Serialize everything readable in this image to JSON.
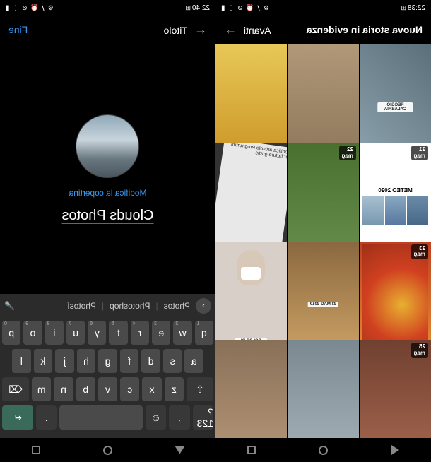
{
  "status": {
    "time_left": "22:38",
    "time_right": "22:40",
    "battery": "32",
    "icons": "⚙ ᚋ ⏰ ⊘ ⋮"
  },
  "left_screen": {
    "header_title": "Nuova storia in evidenza",
    "header_action": "Avanti",
    "tiles": [
      {
        "date": "",
        "bg": "linear-gradient(135deg,#5a6f7a,#8fa5b0)",
        "label": "REGGIO CALABRIA"
      },
      {
        "date": "",
        "bg": "linear-gradient(#b09878,#8a7458)",
        "label": ""
      },
      {
        "date": "",
        "bg": "linear-gradient(#e8c858,#c89020)",
        "label": ""
      },
      {
        "date": "21 mag",
        "bg": "#fff",
        "label": "METEO 2020",
        "meteo": true
      },
      {
        "date": "22 mag",
        "bg": "linear-gradient(#4a7030,#6a9050)",
        "label": ""
      },
      {
        "date": "",
        "bg": "#e8e8e8",
        "label": "Modifica articolo Programmi per fatture gratis",
        "doc": true
      },
      {
        "date": "23 mag",
        "bg": "linear-gradient(#c04020,#e89638)",
        "label": "",
        "pasta": true
      },
      {
        "date": "",
        "bg": "linear-gradient(#8a6840,#d4a868)",
        "label": "23 MAG 2019"
      },
      {
        "date": "",
        "bg": "#d8d0c8",
        "label": "COLPO DI FULMINE",
        "mask": true
      },
      {
        "date": "25 mag",
        "bg": "linear-gradient(#704030,#a86850)",
        "label": ""
      },
      {
        "date": "",
        "bg": "linear-gradient(#7a8890,#a8b4bc)",
        "label": ""
      },
      {
        "date": "",
        "bg": "linear-gradient(#887058,#b89878)",
        "label": ""
      }
    ]
  },
  "right_screen": {
    "header_title": "Titolo",
    "header_action": "Fine",
    "edit_cover": "Modifica la copertina",
    "title_text": "Clouds Photos",
    "suggestions": [
      "Photos",
      "Photoshop",
      "Photosí"
    ],
    "keyboard": {
      "row1": [
        "q",
        "w",
        "e",
        "r",
        "t",
        "y",
        "u",
        "i",
        "o",
        "p"
      ],
      "row1_sup": [
        "1",
        "2",
        "3",
        "4",
        "5",
        "6",
        "7",
        "8",
        "9",
        "0"
      ],
      "row2": [
        "a",
        "s",
        "d",
        "f",
        "g",
        "h",
        "j",
        "k",
        "l"
      ],
      "row3_shift": "⇧",
      "row3": [
        "z",
        "x",
        "c",
        "v",
        "b",
        "n",
        "m"
      ],
      "row3_del": "⌫",
      "row4_sym": "?123",
      "row4_emoji": "☺",
      "row4_enter": "↵"
    }
  }
}
